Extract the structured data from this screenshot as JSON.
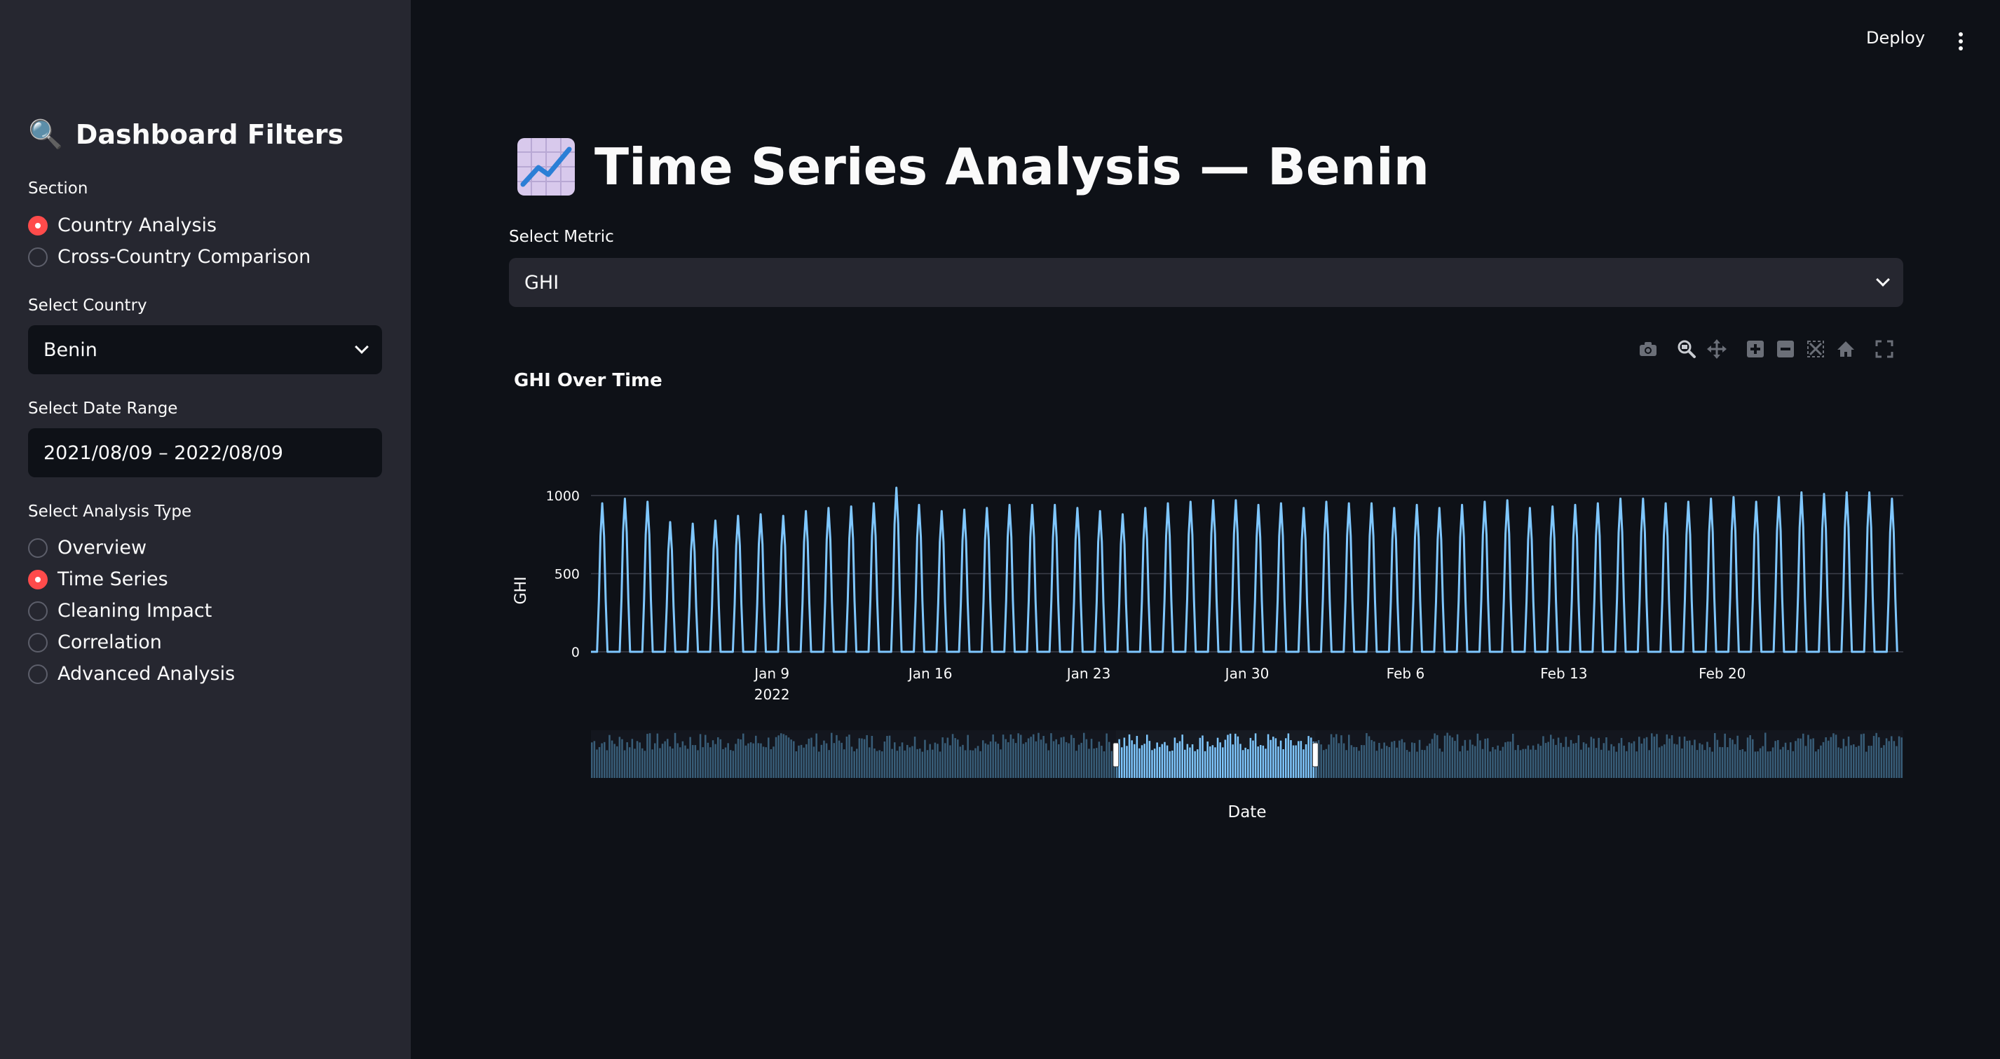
{
  "sidebar": {
    "title_icon": "magnifier-emoji",
    "title": "Dashboard Filters",
    "section_label": "Section",
    "section_options": [
      {
        "label": "Country Analysis",
        "selected": true
      },
      {
        "label": "Cross-Country Comparison",
        "selected": false
      }
    ],
    "country_label": "Select Country",
    "country_value": "Benin",
    "date_label": "Select Date Range",
    "date_value": "2021/08/09 – 2022/08/09",
    "analysis_label": "Select Analysis Type",
    "analysis_options": [
      {
        "label": "Overview",
        "selected": false
      },
      {
        "label": "Time Series",
        "selected": true
      },
      {
        "label": "Cleaning Impact",
        "selected": false
      },
      {
        "label": "Correlation",
        "selected": false
      },
      {
        "label": "Advanced Analysis",
        "selected": false
      }
    ]
  },
  "topbar": {
    "deploy_label": "Deploy"
  },
  "main": {
    "title_icon": "chart-increasing-emoji",
    "title": "Time Series Analysis — Benin",
    "metric_label": "Select Metric",
    "metric_value": "GHI"
  },
  "modebar_icons": [
    "camera-icon",
    "zoom-icon",
    "pan-icon",
    "zoom-in-icon",
    "zoom-out-icon",
    "autoscale-icon",
    "reset-axes-icon",
    "fullscreen-icon"
  ],
  "colors": {
    "accent": "#ff4b4b",
    "series": "#7fc7ff",
    "background": "#0e1117",
    "sidebar": "#262730"
  },
  "chart_data": {
    "type": "line",
    "title": "GHI Over Time",
    "xlabel": "Date",
    "ylabel": "GHI",
    "x_range": [
      "2022-01-01",
      "2022-02-28"
    ],
    "ylim": [
      0,
      1000
    ],
    "yticks": [
      0,
      500,
      1000
    ],
    "xticks": [
      {
        "date": "2022-01-09",
        "label": "Jan 9",
        "sublabel": "2022"
      },
      {
        "date": "2022-01-16",
        "label": "Jan 16",
        "sublabel": ""
      },
      {
        "date": "2022-01-23",
        "label": "Jan 23",
        "sublabel": ""
      },
      {
        "date": "2022-01-30",
        "label": "Jan 30",
        "sublabel": ""
      },
      {
        "date": "2022-02-06",
        "label": "Feb 6",
        "sublabel": ""
      },
      {
        "date": "2022-02-13",
        "label": "Feb 13",
        "sublabel": ""
      },
      {
        "date": "2022-02-20",
        "label": "Feb 20",
        "sublabel": ""
      }
    ],
    "series": [
      {
        "dates": [
          "2022-01-01",
          "2022-01-02",
          "2022-01-03",
          "2022-01-04",
          "2022-01-05",
          "2022-01-06",
          "2022-01-07",
          "2022-01-08",
          "2022-01-09",
          "2022-01-10",
          "2022-01-11",
          "2022-01-12",
          "2022-01-13",
          "2022-01-14",
          "2022-01-15",
          "2022-01-16",
          "2022-01-17",
          "2022-01-18",
          "2022-01-19",
          "2022-01-20",
          "2022-01-21",
          "2022-01-22",
          "2022-01-23",
          "2022-01-24",
          "2022-01-25",
          "2022-01-26",
          "2022-01-27",
          "2022-01-28",
          "2022-01-29",
          "2022-01-30",
          "2022-01-31",
          "2022-02-01",
          "2022-02-02",
          "2022-02-03",
          "2022-02-04",
          "2022-02-05",
          "2022-02-06",
          "2022-02-07",
          "2022-02-08",
          "2022-02-09",
          "2022-02-10",
          "2022-02-11",
          "2022-02-12",
          "2022-02-13",
          "2022-02-14",
          "2022-02-15",
          "2022-02-16",
          "2022-02-17",
          "2022-02-18",
          "2022-02-19",
          "2022-02-20",
          "2022-02-21",
          "2022-02-22",
          "2022-02-23",
          "2022-02-24",
          "2022-02-25",
          "2022-02-26",
          "2022-02-27"
        ],
        "daily_peak": [
          950,
          980,
          960,
          830,
          820,
          840,
          870,
          880,
          870,
          900,
          920,
          930,
          950,
          1050,
          940,
          900,
          910,
          920,
          940,
          940,
          940,
          920,
          900,
          880,
          920,
          950,
          960,
          970,
          970,
          940,
          950,
          920,
          960,
          950,
          950,
          920,
          940,
          920,
          940,
          960,
          970,
          920,
          930,
          940,
          950,
          980,
          980,
          950,
          960,
          980,
          990,
          960,
          990,
          1020,
          1010,
          1020,
          1020,
          980
        ]
      }
    ],
    "range_slider": {
      "window": [
        "2022-01-01",
        "2022-02-28"
      ]
    }
  }
}
